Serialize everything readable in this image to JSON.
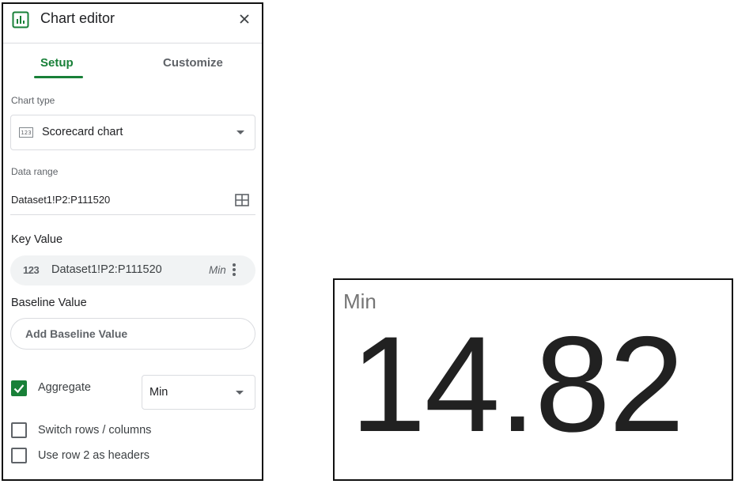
{
  "editor": {
    "title": "Chart editor",
    "close_icon": "close-icon",
    "tabs": [
      {
        "label": "Setup",
        "active": true
      },
      {
        "label": "Customize",
        "active": false
      }
    ],
    "chart_type": {
      "label": "Chart type",
      "icon_text": "123",
      "value": "Scorecard chart"
    },
    "data_range": {
      "label": "Data range",
      "value": "Dataset1!P2:P111520"
    },
    "key_value": {
      "heading": "Key Value",
      "icon_text": "123",
      "range": "Dataset1!P2:P111520",
      "aggregation": "Min"
    },
    "baseline": {
      "heading": "Baseline Value",
      "placeholder": "Add Baseline Value"
    },
    "options": {
      "aggregate": {
        "label": "Aggregate",
        "checked": true,
        "value": "Min"
      },
      "switch_rows": {
        "label": "Switch rows / columns",
        "checked": false
      },
      "use_row_headers": {
        "label": "Use row 2 as headers",
        "checked": false
      }
    },
    "accent_color": "#188038"
  },
  "scorecard": {
    "title": "Min",
    "value": "14.82"
  }
}
